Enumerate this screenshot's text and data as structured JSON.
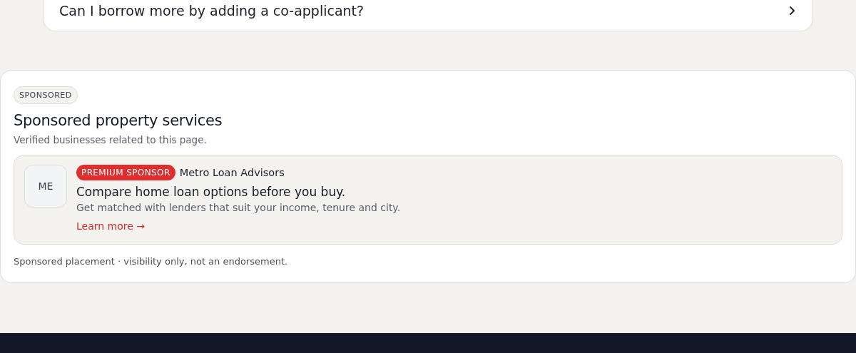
{
  "faq": {
    "question": "Can I borrow more by adding a co-applicant?",
    "expanded": false
  },
  "sponsored": {
    "tag": "SPONSORED",
    "title": "Sponsored property services",
    "subtitle": "Verified businesses related to this page.",
    "ads": [
      {
        "initials": "ME",
        "badge": "PREMIUM SPONSOR",
        "advertiser": "Metro Loan Advisors",
        "headline": "Compare home loan options before you buy.",
        "description": "Get matched with lenders that suit your income, tenure and city.",
        "link": "Learn more →"
      }
    ],
    "note": "Sponsored placement · visibility only, not an endorsement."
  }
}
